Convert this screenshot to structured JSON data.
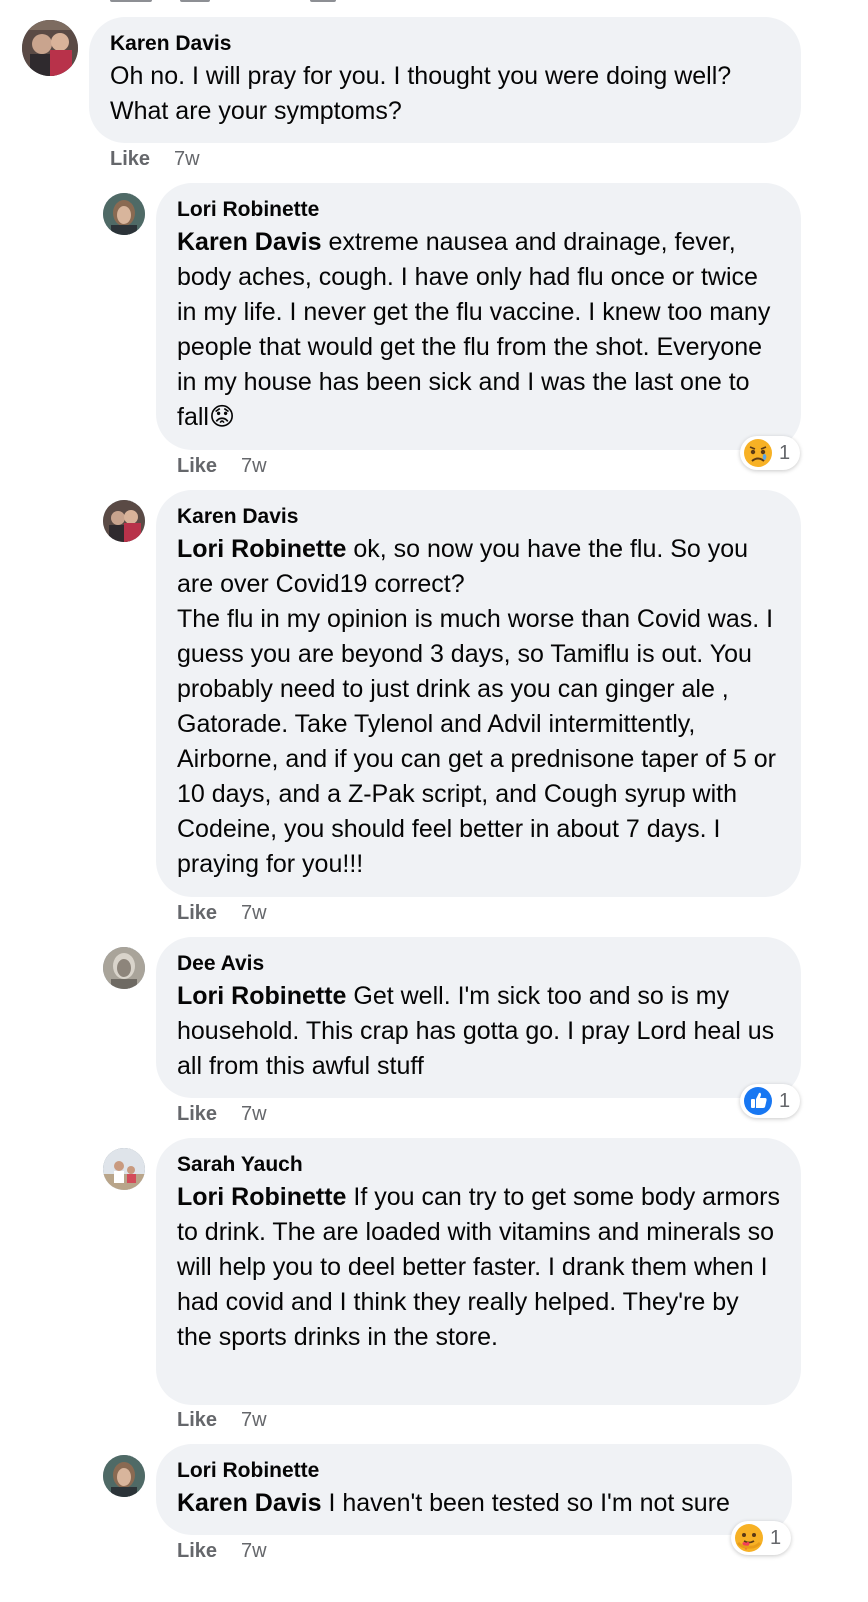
{
  "comments": [
    {
      "author": "Karen Davis",
      "mention": "",
      "text": "Oh no. I will pray for you. I thought you were doing well? What are your symptoms?",
      "like_label": "Like",
      "time": "7w",
      "reaction_count": ""
    },
    {
      "author": "Lori Robinette",
      "mention": "Karen Davis",
      "text": " extreme nausea and drainage, fever, body aches, cough. I have only had flu once or twice in my life. I never get the flu vaccine. I knew too many people that would get the flu from the shot. Everyone in my house has been sick and I was the last one to fall",
      "emoji": "😟",
      "like_label": "Like",
      "time": "7w",
      "reaction_count": "1",
      "reaction_icon": "sad-reaction-icon"
    },
    {
      "author": "Karen Davis",
      "mention": "Lori Robinette",
      "text": " ok, so now you have the flu. So you are over Covid19 correct?\nThe flu in my opinion is much worse than Covid was. I guess you are beyond 3 days, so Tamiflu is out. You probably need to just drink as you can ginger ale , Gatorade. Take Tylenol and Advil intermittently, Airborne, and if you can get a prednisone taper of 5 or 10 days, and a Z-Pak script, and Cough syrup with Codeine, you should feel better in about 7 days. I praying for you!!!",
      "like_label": "Like",
      "time": "7w",
      "reaction_count": ""
    },
    {
      "author": "Dee Avis",
      "mention": "Lori Robinette",
      "text": " Get well. I'm sick too and so is my household. This crap has gotta go. I pray Lord heal us all from this awful stuff",
      "like_label": "Like",
      "time": "7w",
      "reaction_count": "1",
      "reaction_icon": "like-reaction-icon"
    },
    {
      "author": "Sarah Yauch",
      "mention": "Lori Robinette",
      "text": " If you can try to get some body armors to drink. The are loaded with vitamins and minerals so will help you to deel better faster. I drank them when I had covid and I think they really helped. They're by the sports drinks in the store.",
      "like_label": "Like",
      "time": "7w",
      "reaction_count": ""
    },
    {
      "author": "Lori Robinette",
      "mention": "Karen Davis",
      "text": " I haven't been tested so I'm not sure",
      "like_label": "Like",
      "time": "7w",
      "reaction_count": "1",
      "reaction_icon": "care-reaction-icon"
    }
  ],
  "colors": {
    "bubble_bg": "#f0f2f5",
    "meta_text": "#65676b",
    "like_blue": "#1877f2",
    "reaction_yellow": "#f7b125"
  }
}
